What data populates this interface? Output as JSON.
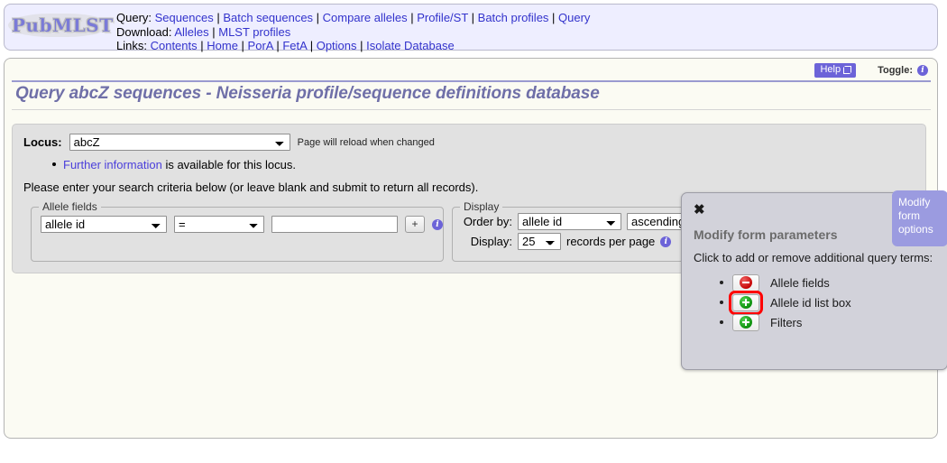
{
  "header": {
    "logo_text": "PubMLST",
    "rows": [
      {
        "label": "Query:",
        "links": [
          "Sequences",
          "Batch sequences",
          "Compare alleles",
          "Profile/ST",
          "Batch profiles",
          "Query"
        ]
      },
      {
        "label": "Download:",
        "links": [
          "Alleles",
          "MLST profiles"
        ]
      },
      {
        "label": "Links:",
        "links": [
          "Contents",
          "Home",
          "PorA",
          "FetA",
          "Options",
          "Isolate Database"
        ]
      }
    ]
  },
  "toolbar": {
    "help_label": "Help",
    "toggle_label": "Toggle:"
  },
  "page": {
    "title": "Query abcZ sequences - Neisseria profile/sequence definitions database"
  },
  "form": {
    "locus_label": "Locus:",
    "locus_value": "abcZ",
    "locus_note": "Page will reload when changed",
    "further_info_link": "Further information",
    "further_info_rest": " is available for this locus.",
    "instruction": "Please enter your search criteria below (or leave blank and submit to return all records).",
    "allele_fields": {
      "legend": "Allele fields",
      "field_value": "allele id",
      "operator_value": "=",
      "value_input": "",
      "value_placeholder": "",
      "add_button_label": "+"
    },
    "display": {
      "legend": "Display",
      "order_by_label": "Order by:",
      "order_by_value": "allele id",
      "direction_value": "ascending",
      "display_label": "Display:",
      "records_value": "25",
      "records_suffix": "records per page"
    }
  },
  "modal": {
    "tab_label": "Modify form options",
    "close_label": "✖",
    "title": "Modify form parameters",
    "subtitle": "Click to add or remove additional query terms:",
    "items": [
      {
        "label": "Allele fields",
        "state": "remove",
        "highlighted": false
      },
      {
        "label": "Allele id list box",
        "state": "add",
        "highlighted": true
      },
      {
        "label": "Filters",
        "state": "add",
        "highlighted": false
      }
    ]
  },
  "colors": {
    "accent_purple": "#6c63d8",
    "link_blue": "#3333cc",
    "title_purple": "#6f6fa8",
    "header_bg": "#eeeeff",
    "panel_bg": "#fbfbf3",
    "form_bg": "#e1e1e1",
    "modal_bg": "#d2d2da",
    "tab_bg": "#9b9be0",
    "highlight_red": "#ff0000",
    "icon_green": "#0a8c0a",
    "icon_red": "#c30000"
  }
}
